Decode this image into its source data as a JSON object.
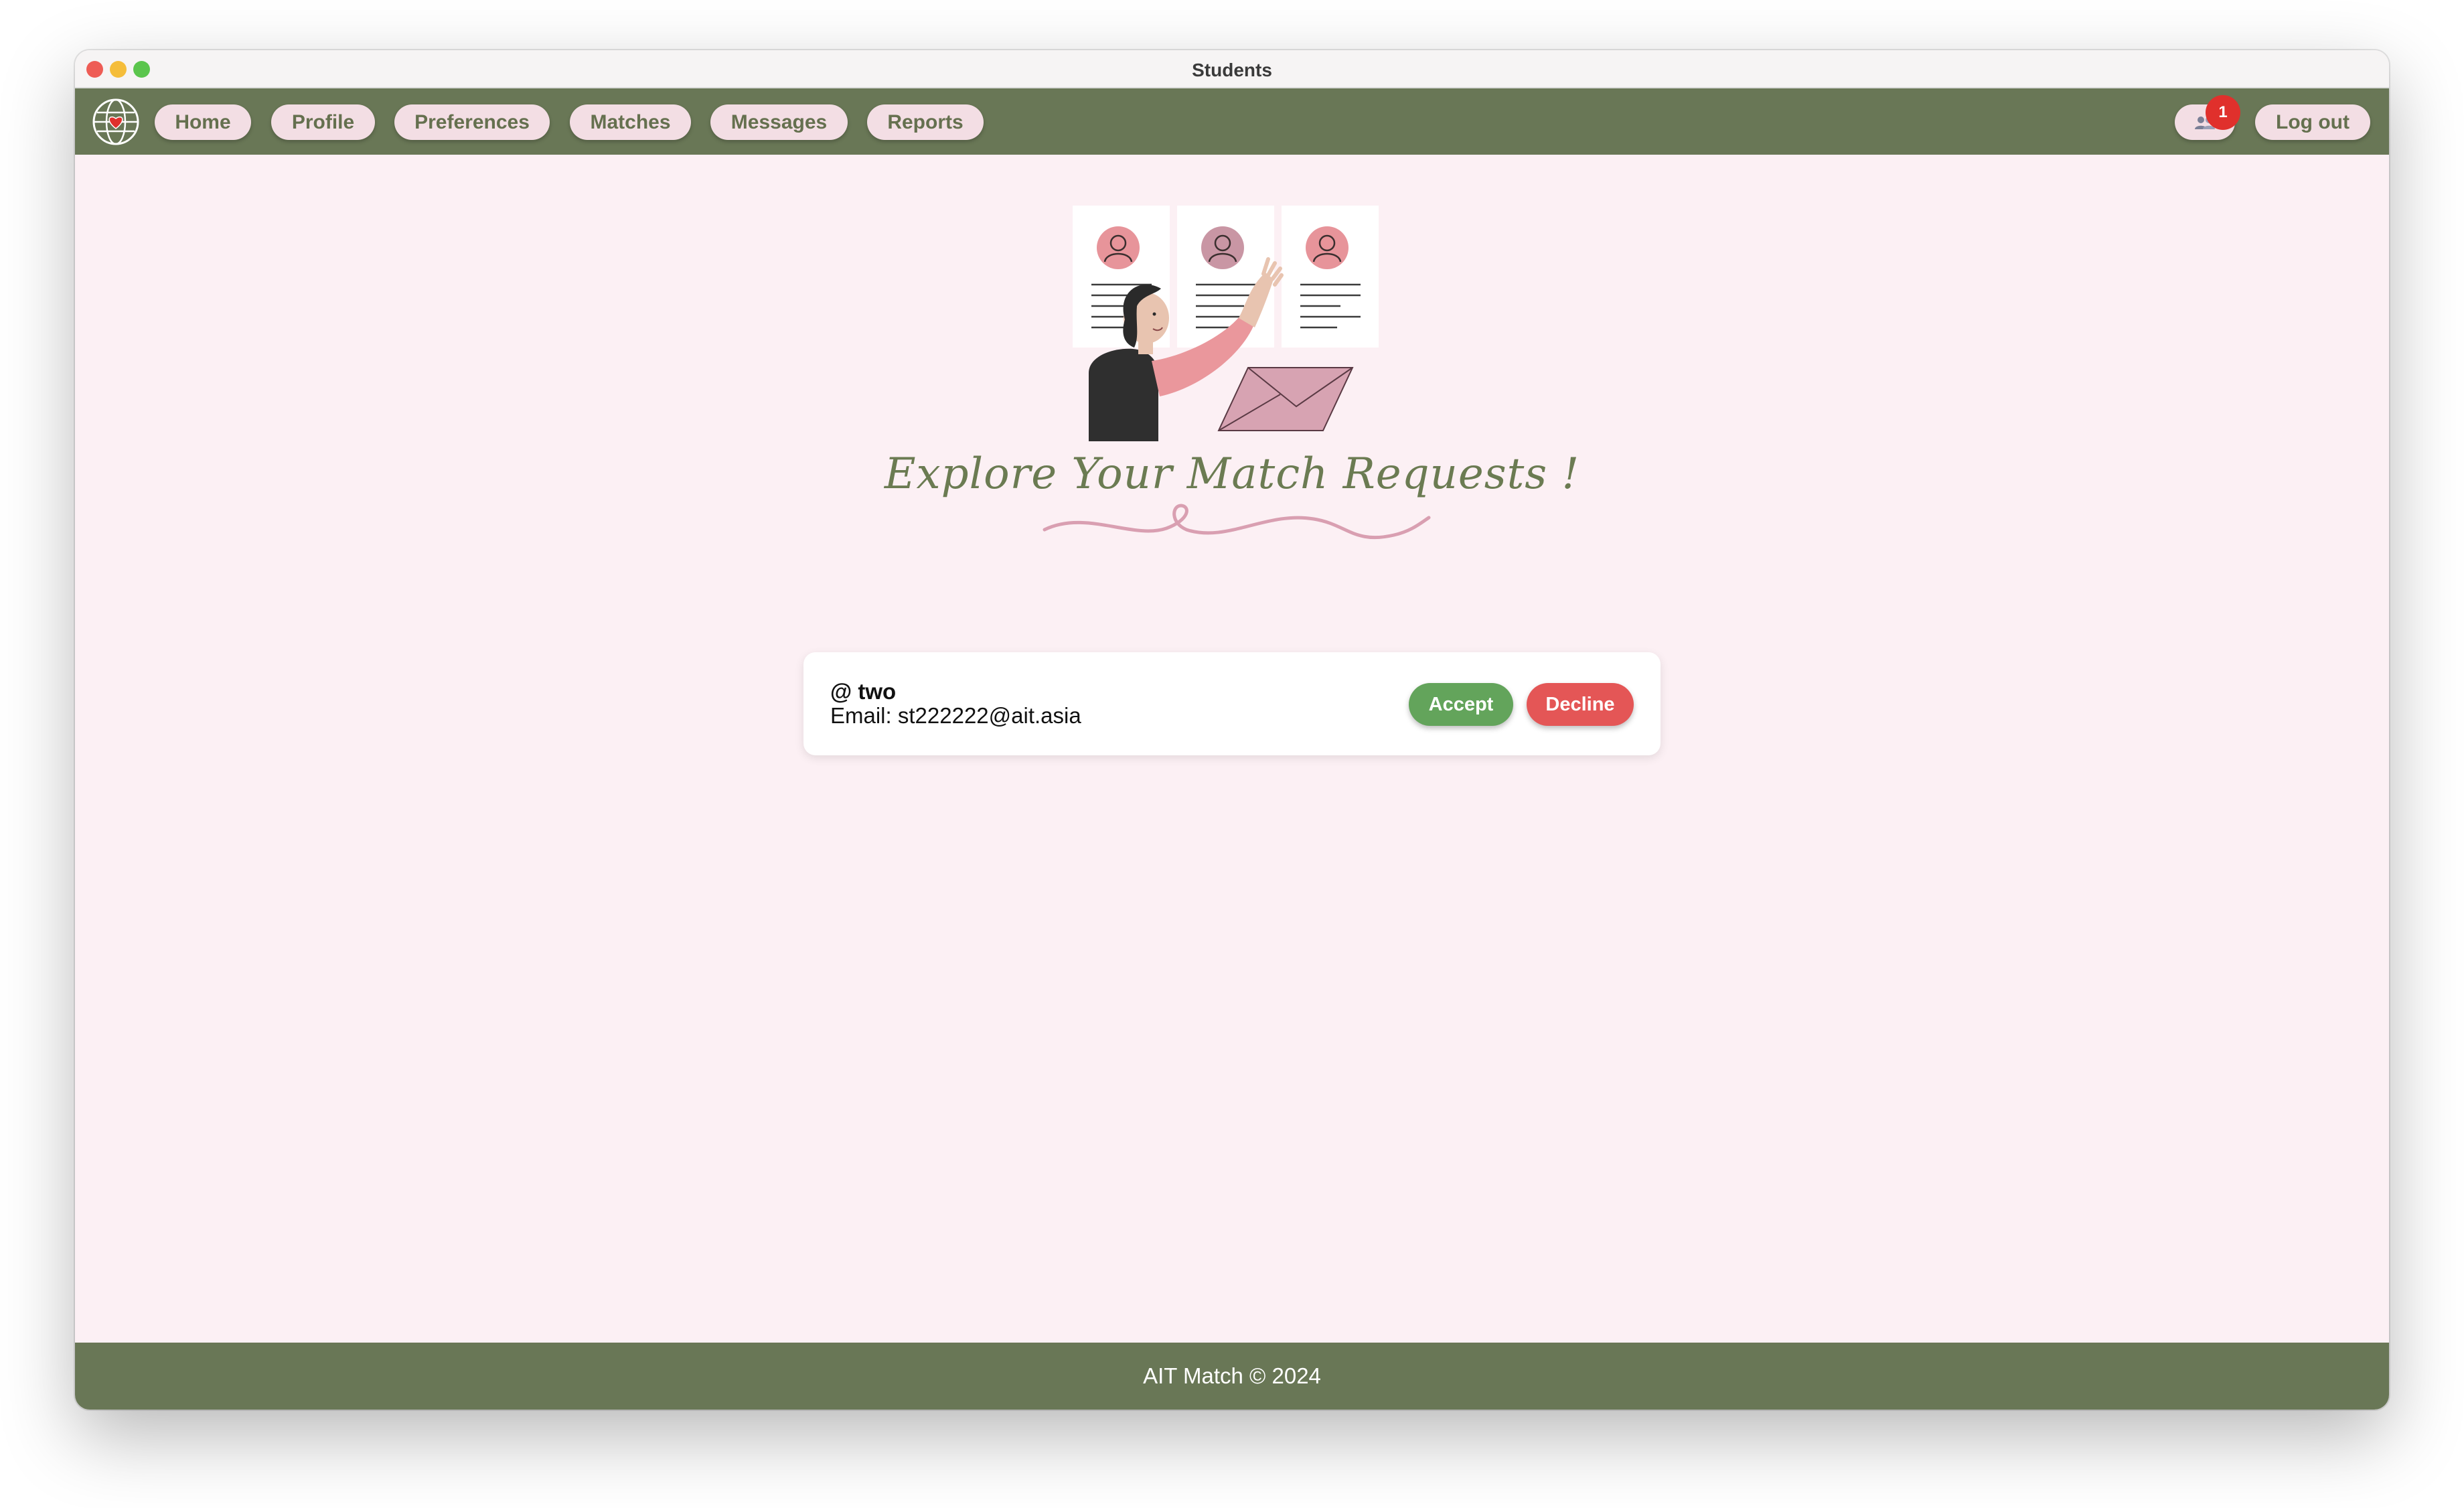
{
  "window": {
    "title": "Students"
  },
  "nav": {
    "items": [
      {
        "label": "Home"
      },
      {
        "label": "Profile"
      },
      {
        "label": "Preferences"
      },
      {
        "label": "Matches"
      },
      {
        "label": "Messages"
      },
      {
        "label": "Reports"
      }
    ],
    "notification_icon": "people-icon",
    "notification_count": "1",
    "logout_label": "Log out"
  },
  "main": {
    "heading": "Explore Your Match Requests !"
  },
  "requests": [
    {
      "username": "@ two",
      "email_label": "Email:",
      "email": "st222222@ait.asia",
      "accept_label": "Accept",
      "decline_label": "Decline"
    }
  ],
  "footer": {
    "text": "AIT Match © 2024"
  },
  "colors": {
    "nav_bg": "#697756",
    "page_bg": "#fcf0f4",
    "nav_pill": "#f3dee4",
    "accept": "#63a45b",
    "decline": "#e45656",
    "badge": "#e0302c"
  }
}
